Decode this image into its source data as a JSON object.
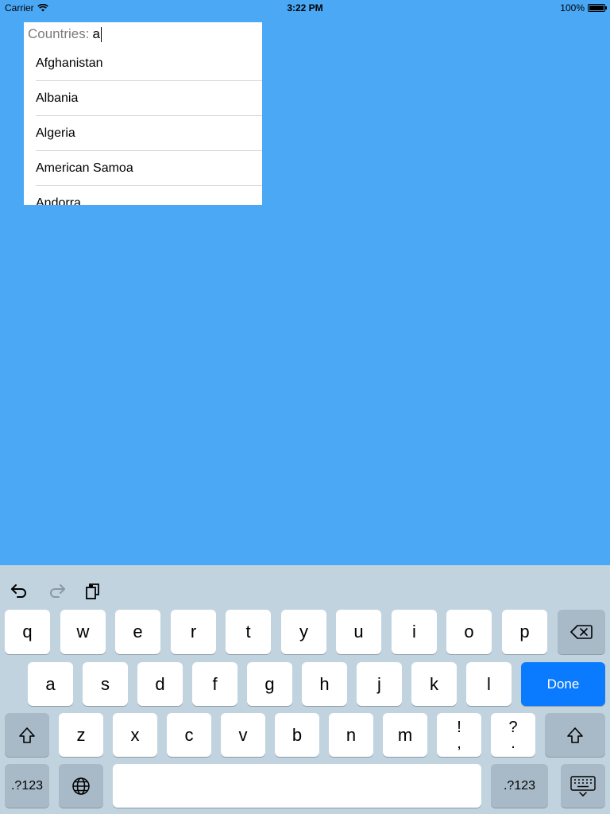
{
  "status_bar": {
    "carrier": "Carrier",
    "time": "3:22 PM",
    "battery_percent": "100%",
    "battery_level": 1.0
  },
  "search": {
    "label": "Countries:",
    "value": "a"
  },
  "countries": [
    "Afghanistan",
    "Albania",
    "Algeria",
    "American Samoa",
    "Andorra"
  ],
  "keyboard": {
    "row1": [
      "q",
      "w",
      "e",
      "r",
      "t",
      "y",
      "u",
      "i",
      "o",
      "p"
    ],
    "row2": [
      "a",
      "s",
      "d",
      "f",
      "g",
      "h",
      "j",
      "k",
      "l"
    ],
    "row3": [
      "z",
      "x",
      "c",
      "v",
      "b",
      "n",
      "m"
    ],
    "exclaim_top": "!",
    "exclaim_bottom": ",",
    "question_top": "?",
    "question_bottom": ".",
    "done_label": "Done",
    "numbers_label": ".?123"
  },
  "colors": {
    "background": "#4aa8f5",
    "keyboard_bg": "#c1d3df",
    "done_key": "#0a7aff"
  }
}
